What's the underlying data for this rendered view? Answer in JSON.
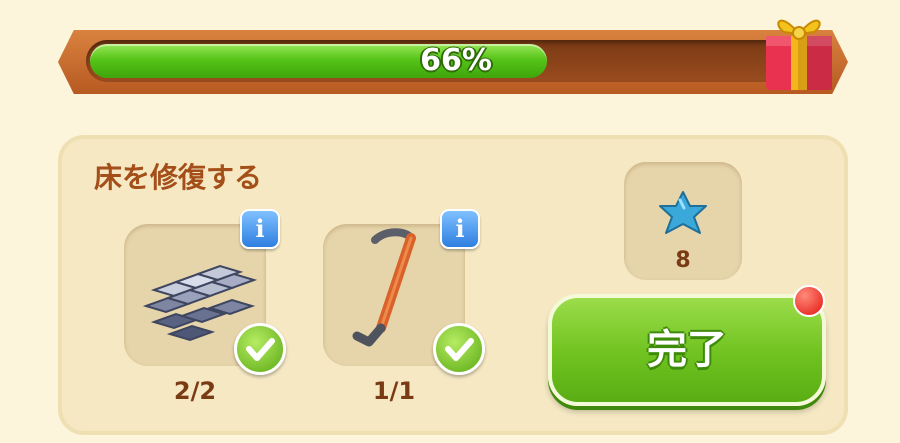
{
  "progress": {
    "percent": 66,
    "label": "66%"
  },
  "task": {
    "title": "床を修復する",
    "items": [
      {
        "icon": "stone-tiles-icon",
        "count": "2/2",
        "completed": true
      },
      {
        "icon": "crowbar-icon",
        "count": "1/1",
        "completed": true
      }
    ],
    "info_label": "i",
    "reward": {
      "icon": "blue-star-icon",
      "count": "8"
    },
    "complete_button": {
      "label": "完了",
      "has_notification": true
    }
  },
  "colors": {
    "progress_fill": "#55c417",
    "title_text": "#a44f19",
    "button_green": "#6fc21f",
    "notification_red": "#e3150f"
  }
}
